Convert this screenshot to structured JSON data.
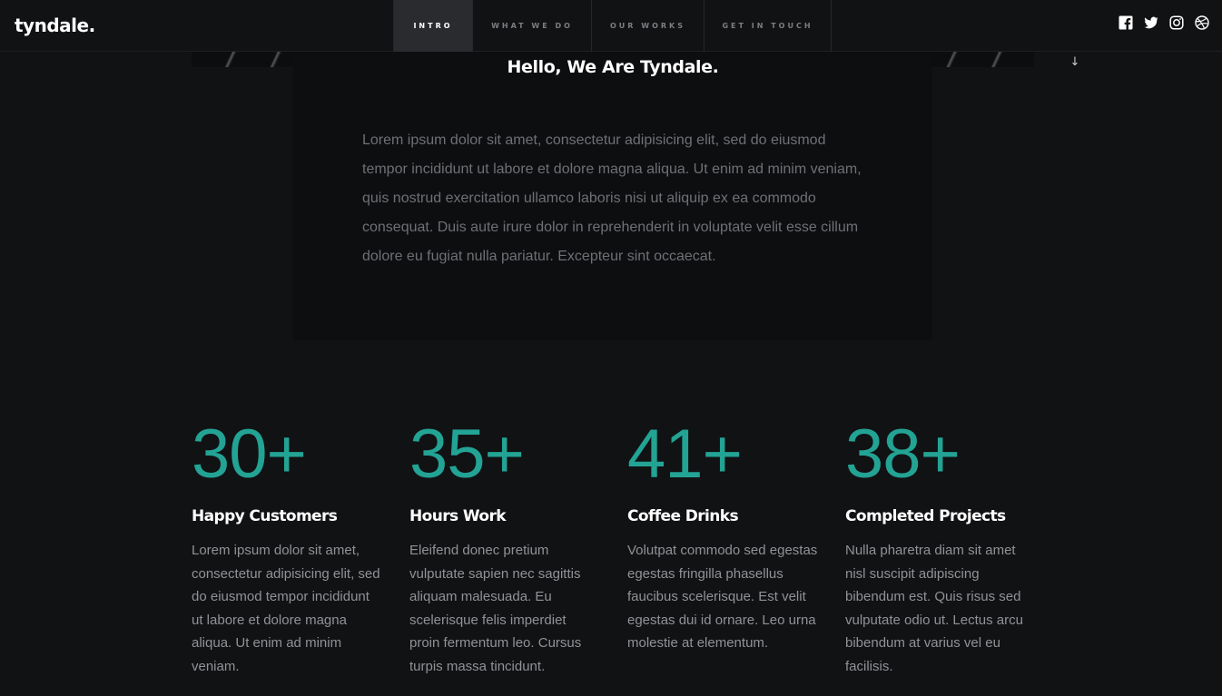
{
  "header": {
    "logo": "tyndale.",
    "nav": [
      {
        "label": "INTRO",
        "active": true
      },
      {
        "label": "WHAT WE DO",
        "active": false
      },
      {
        "label": "OUR WORKS",
        "active": false
      },
      {
        "label": "GET IN TOUCH",
        "active": false
      }
    ],
    "social_icons": [
      "facebook-icon",
      "twitter-icon",
      "instagram-icon",
      "dribbble-icon"
    ]
  },
  "intro": {
    "title": "Hello, We Are Tyndale.",
    "text": "Lorem ipsum dolor sit amet, consectetur adipisicing elit, sed do eiusmod tempor incididunt ut labore et dolore magna aliqua. Ut enim ad minim veniam, quis nostrud exercitation ullamco laboris nisi ut aliquip ex ea commodo consequat. Duis aute irure dolor in reprehenderit in voluptate velit esse cillum dolore eu fugiat nulla pariatur. Excepteur sint occaecat.",
    "scroll_icon": "arrow-down-icon"
  },
  "stats": [
    {
      "number": "30+",
      "label": "Happy Customers",
      "text": "Lorem ipsum dolor sit amet, consectetur adipisicing elit, sed do eiusmod tempor incididunt ut labore et dolore magna aliqua. Ut enim ad minim veniam."
    },
    {
      "number": "35+",
      "label": "Hours Work",
      "text": "Eleifend donec pretium vulputate sapien nec sagittis aliquam malesuada. Eu scelerisque felis imperdiet proin fermentum leo. Cursus turpis massa tincidunt."
    },
    {
      "number": "41+",
      "label": "Coffee Drinks",
      "text": "Volutpat commodo sed egestas egestas fringilla phasellus faucibus scelerisque. Est velit egestas dui id ornare. Leo urna molestie at elementum."
    },
    {
      "number": "38+",
      "label": "Completed Projects",
      "text": "Nulla pharetra diam sit amet nisl suscipit adipiscing bibendum est. Quis risus sed vulputate odio ut. Lectus arcu bibendum at varius vel eu facilisis."
    }
  ],
  "colors": {
    "background": "#111214",
    "accent": "#23a394",
    "text_muted": "#909296",
    "nav_active_bg": "#2a2b2e"
  }
}
